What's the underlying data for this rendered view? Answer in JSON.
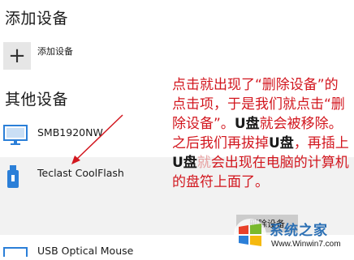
{
  "sections": {
    "add_title": "添加设备",
    "other_title": "其他设备"
  },
  "add_device": {
    "icon": "plus-icon",
    "label": "添加设备"
  },
  "devices": [
    {
      "name": "SMB1920NW",
      "icon": "monitor-icon"
    },
    {
      "name": "Teclast CoolFlash",
      "icon": "usb-drive-icon",
      "selected": true
    },
    {
      "name": "USB Optical Mouse",
      "icon": "mouse-icon"
    }
  ],
  "selected_device_action": "删除设备",
  "annotation": {
    "part1": "点击就出现了“删除设备”的点击项，于是我们就点击“删除设备”。",
    "part2": "U盘",
    "part3": "就会被移除。之后我们再拔掉",
    "part4": "U盘",
    "part5": "，再插上",
    "part6": "U盘",
    "part7": "就",
    "part8": "会出现在电脑的计算机的盘符上面了。"
  },
  "watermark": {
    "title": "系统之家",
    "url": "Www.Winwin7.com"
  },
  "colors": {
    "annotation": "#d2161e",
    "selected_row": "#f2f2f2",
    "button": "#cccccc",
    "device_icon": "#2b7fd8"
  }
}
